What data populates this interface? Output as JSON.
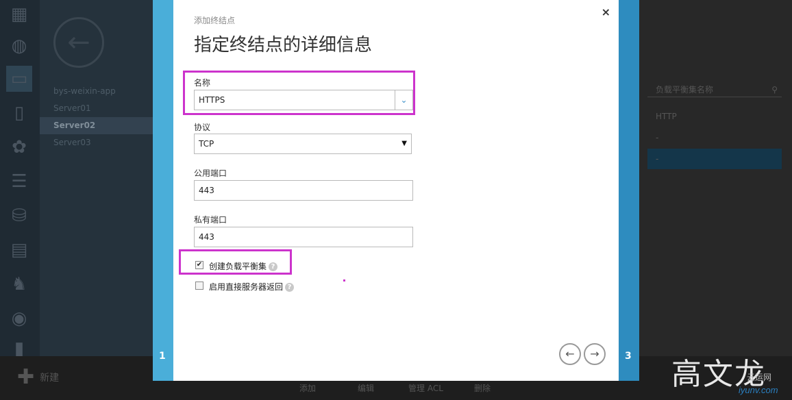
{
  "wizard": {
    "subtitle": "添加终结点",
    "title": "指定终结点的详细信息",
    "close": "×",
    "step_left": "1",
    "step_right": "3",
    "name_label": "名称",
    "name_value": "HTTPS",
    "protocol_label": "协议",
    "protocol_value": "TCP",
    "public_port_label": "公用端口",
    "public_port_value": "443",
    "private_port_label": "私有端口",
    "private_port_value": "443",
    "create_lb_label": "创建负载平衡集",
    "create_lb_checked": true,
    "dsr_label": "启用直接服务器返回",
    "dsr_checked": false,
    "help": "?",
    "prev": "←",
    "next": "→"
  },
  "subnav": {
    "items": [
      "bys-weixin-app",
      "Server01",
      "Server02",
      "Server03"
    ],
    "selected": "Server02"
  },
  "rightpane": {
    "column_header": "负载平衡集名称",
    "rows": [
      "HTTP",
      "-",
      "-"
    ]
  },
  "commandbar": {
    "new_label": "新建",
    "commands": [
      "添加",
      "编辑",
      "管理 ACL",
      "删除"
    ]
  },
  "watermark": {
    "text": "高文龙",
    "site": "iyunv.com",
    "site_cn": "云运网"
  }
}
